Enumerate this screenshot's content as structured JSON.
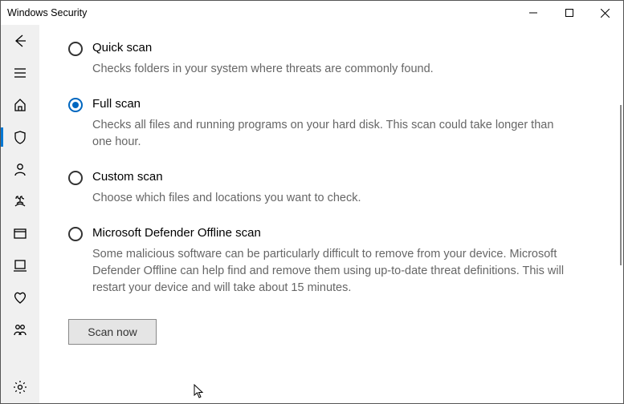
{
  "window": {
    "title": "Windows Security"
  },
  "sidebar": {
    "items": [
      {
        "name": "back-icon"
      },
      {
        "name": "menu-icon"
      },
      {
        "name": "home-icon"
      },
      {
        "name": "shield-icon",
        "active": true
      },
      {
        "name": "account-icon"
      },
      {
        "name": "firewall-icon"
      },
      {
        "name": "app-browser-icon"
      },
      {
        "name": "device-security-icon"
      },
      {
        "name": "health-icon"
      },
      {
        "name": "family-icon"
      }
    ],
    "footer": {
      "name": "settings-icon"
    }
  },
  "scan": {
    "options": [
      {
        "id": "quick",
        "label": "Quick scan",
        "description": "Checks folders in your system where threats are commonly found.",
        "selected": false
      },
      {
        "id": "full",
        "label": "Full scan",
        "description": "Checks all files and running programs on your hard disk. This scan could take longer than one hour.",
        "selected": true
      },
      {
        "id": "custom",
        "label": "Custom scan",
        "description": "Choose which files and locations you want to check.",
        "selected": false
      },
      {
        "id": "offline",
        "label": "Microsoft Defender Offline scan",
        "description": "Some malicious software can be particularly difficult to remove from your device. Microsoft Defender Offline can help find and remove them using up-to-date threat definitions. This will restart your device and will take about 15 minutes.",
        "selected": false
      }
    ],
    "button_label": "Scan now"
  }
}
